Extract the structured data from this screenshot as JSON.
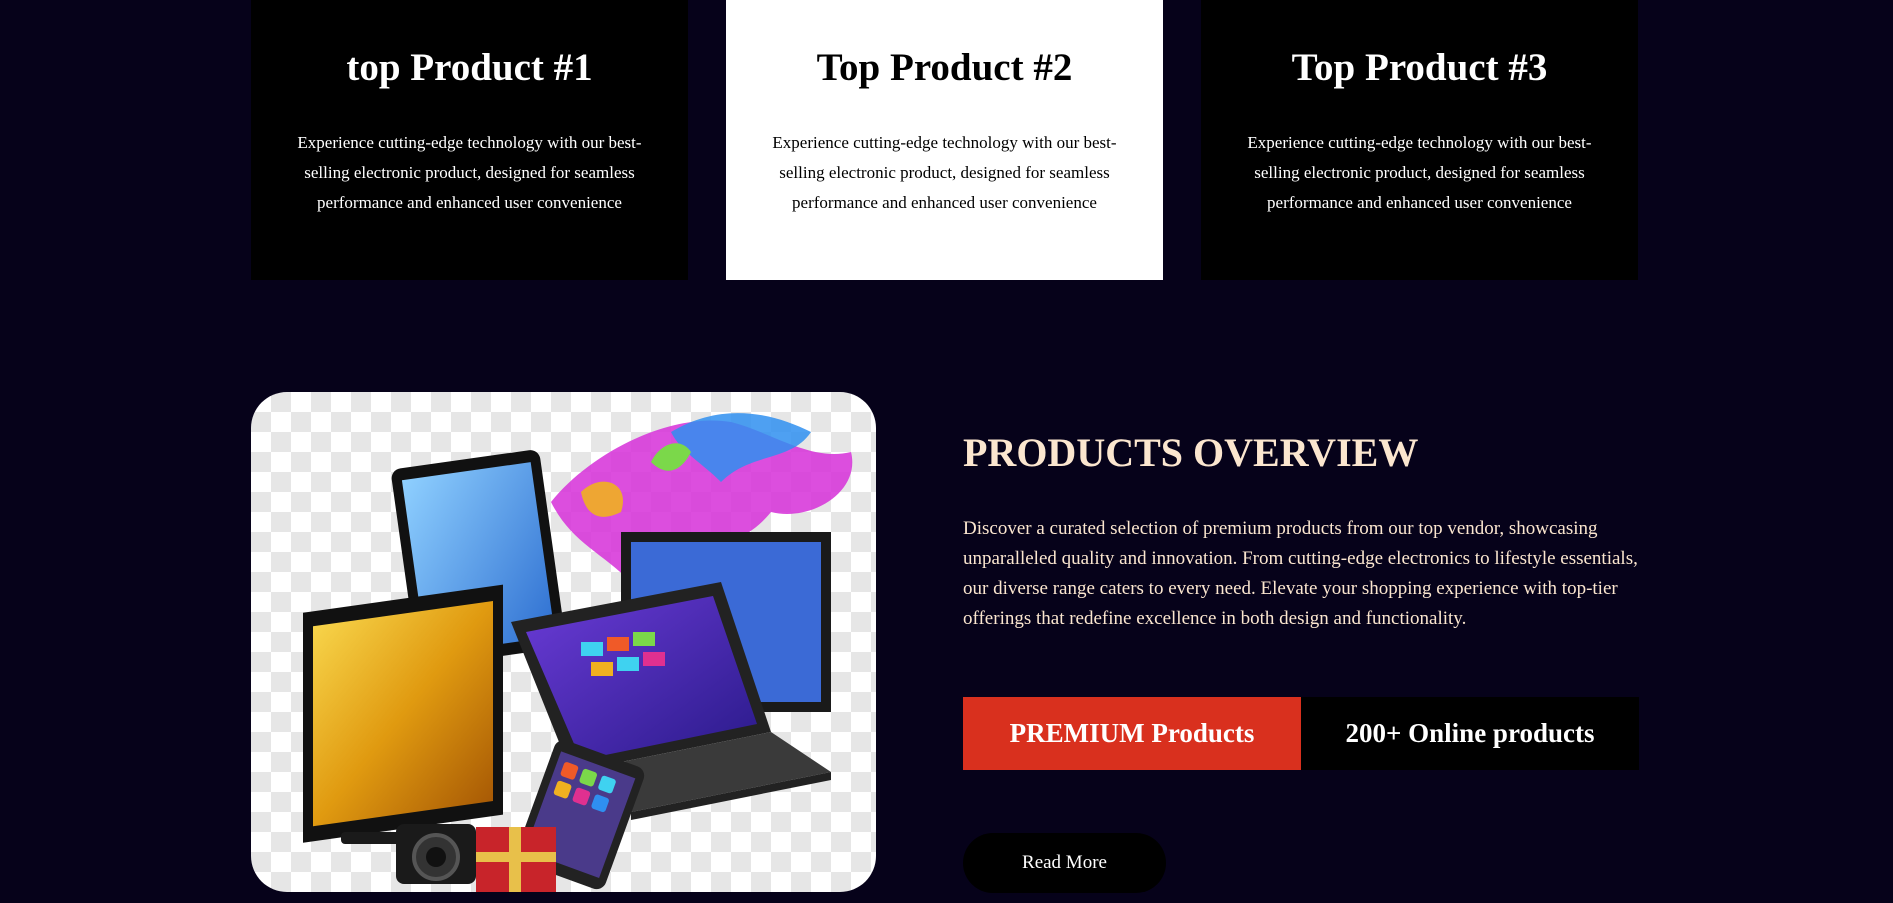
{
  "top_products": [
    {
      "title": "top Product #1",
      "description": "Experience cutting-edge technology with our best-selling electronic product, designed for seamless performance and enhanced user convenience"
    },
    {
      "title": "Top Product #2",
      "description": "Experience cutting-edge technology with our best-selling electronic product, designed for seamless performance and enhanced user convenience"
    },
    {
      "title": "Top Product #3",
      "description": "Experience cutting-edge technology with our best-selling electronic product, designed for seamless performance and enhanced user convenience"
    }
  ],
  "overview": {
    "title": "PRODUCTS OVERVIEW",
    "description": "Discover a curated selection of premium products from our top vendor, showcasing unparalleled quality and innovation. From cutting-edge electronics to lifestyle essentials, our diverse range caters to every need. Elevate your shopping experience with top-tier offerings that redefine excellence in both design and functionality.",
    "stat_premium": "PREMIUM Products",
    "stat_online": "200+ Online products",
    "read_more_label": "Read More"
  },
  "colors": {
    "page_background": "#06021a",
    "accent_red": "#d9301e",
    "heading_cream": "#fbe6cf"
  },
  "image": {
    "icon": "electronics-collage-image"
  }
}
